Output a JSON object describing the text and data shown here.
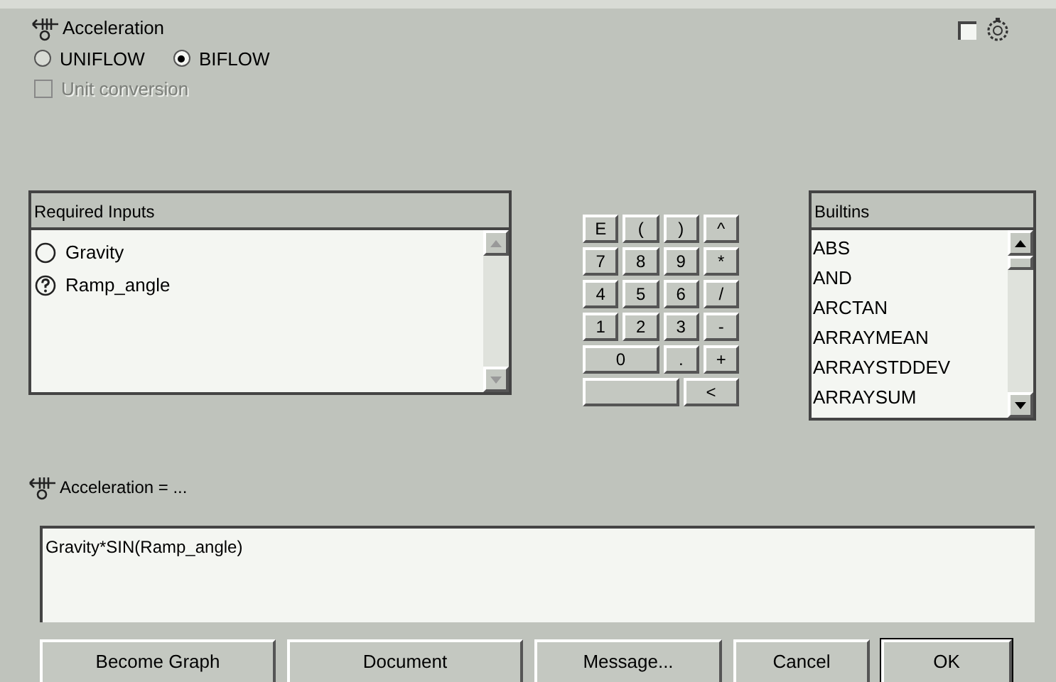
{
  "variable": {
    "name": "Acceleration",
    "flow_options": [
      {
        "label": "UNIFLOW",
        "selected": false
      },
      {
        "label": "BIFLOW",
        "selected": true
      }
    ],
    "unit_conversion": {
      "label": "Unit conversion",
      "checked": false,
      "disabled": true
    }
  },
  "top_checkbox": {
    "checked": false
  },
  "required_inputs": {
    "title": "Required Inputs",
    "items": [
      {
        "label": "Gravity",
        "kind": "defined"
      },
      {
        "label": "Ramp_angle",
        "kind": "unknown"
      }
    ]
  },
  "keypad": [
    [
      {
        "label": "E",
        "kind": "narrow"
      },
      {
        "label": "(",
        "kind": "narrow"
      },
      {
        "label": ")",
        "kind": "narrow"
      },
      {
        "label": "^",
        "kind": "narrow"
      }
    ],
    [
      {
        "label": "7",
        "kind": "narrow"
      },
      {
        "label": "8",
        "kind": "narrow"
      },
      {
        "label": "9",
        "kind": "narrow"
      },
      {
        "label": "*",
        "kind": "narrow"
      }
    ],
    [
      {
        "label": "4",
        "kind": "narrow"
      },
      {
        "label": "5",
        "kind": "narrow"
      },
      {
        "label": "6",
        "kind": "narrow"
      },
      {
        "label": "/",
        "kind": "narrow"
      }
    ],
    [
      {
        "label": "1",
        "kind": "narrow"
      },
      {
        "label": "2",
        "kind": "narrow"
      },
      {
        "label": "3",
        "kind": "narrow"
      },
      {
        "label": "-",
        "kind": "narrow"
      }
    ],
    [
      {
        "label": "0",
        "kind": "double"
      },
      {
        "label": ".",
        "kind": "narrow"
      },
      {
        "label": "+",
        "kind": "narrow"
      }
    ],
    [
      {
        "kind": "blank"
      },
      {
        "label": "<",
        "kind": "tail"
      }
    ]
  ],
  "builtins": {
    "title": "Builtins",
    "items": [
      "ABS",
      "AND",
      "ARCTAN",
      "ARRAYMEAN",
      "ARRAYSTDDEV",
      "ARRAYSUM"
    ]
  },
  "equation": {
    "label": "Acceleration = ...",
    "value": "Gravity*SIN(Ramp_angle)"
  },
  "buttons": [
    "Become Graph",
    "Document",
    "Message...",
    "Cancel",
    "OK"
  ]
}
